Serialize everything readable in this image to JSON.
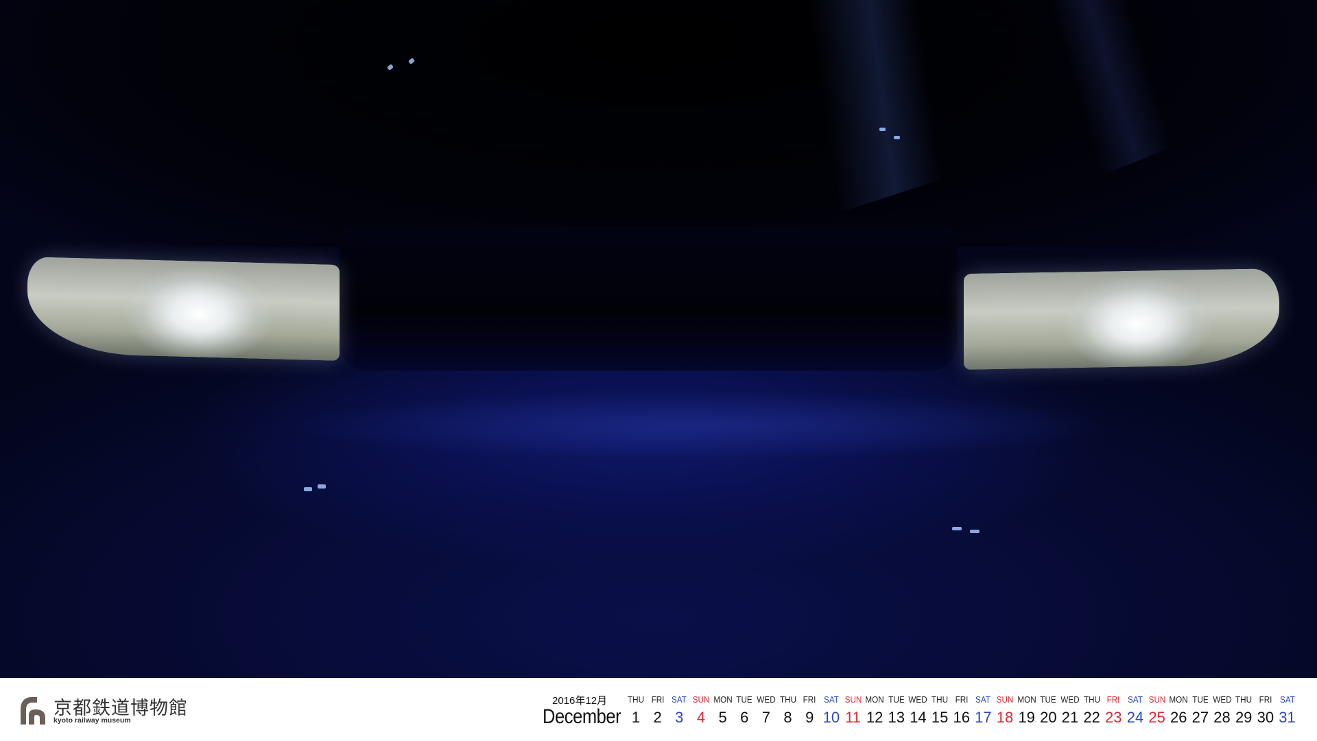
{
  "photo": {
    "subject": "train-front-headlights"
  },
  "logo": {
    "name_jp": "京都鉄道博物館",
    "name_en": "kyoto railway museum"
  },
  "calendar": {
    "year_month": "2016年12月",
    "month": "December",
    "days": [
      {
        "dow": "THU",
        "num": "1",
        "type": "weekday"
      },
      {
        "dow": "FRI",
        "num": "2",
        "type": "weekday"
      },
      {
        "dow": "SAT",
        "num": "3",
        "type": "sat"
      },
      {
        "dow": "SUN",
        "num": "4",
        "type": "sun"
      },
      {
        "dow": "MON",
        "num": "5",
        "type": "weekday"
      },
      {
        "dow": "TUE",
        "num": "6",
        "type": "weekday"
      },
      {
        "dow": "WED",
        "num": "7",
        "type": "weekday"
      },
      {
        "dow": "THU",
        "num": "8",
        "type": "weekday"
      },
      {
        "dow": "FRI",
        "num": "9",
        "type": "weekday"
      },
      {
        "dow": "SAT",
        "num": "10",
        "type": "sat"
      },
      {
        "dow": "SUN",
        "num": "11",
        "type": "sun"
      },
      {
        "dow": "MON",
        "num": "12",
        "type": "weekday"
      },
      {
        "dow": "TUE",
        "num": "13",
        "type": "weekday"
      },
      {
        "dow": "WED",
        "num": "14",
        "type": "weekday"
      },
      {
        "dow": "THU",
        "num": "15",
        "type": "weekday"
      },
      {
        "dow": "FRI",
        "num": "16",
        "type": "weekday"
      },
      {
        "dow": "SAT",
        "num": "17",
        "type": "sat"
      },
      {
        "dow": "SUN",
        "num": "18",
        "type": "sun"
      },
      {
        "dow": "MON",
        "num": "19",
        "type": "weekday"
      },
      {
        "dow": "TUE",
        "num": "20",
        "type": "weekday"
      },
      {
        "dow": "WED",
        "num": "21",
        "type": "weekday"
      },
      {
        "dow": "THU",
        "num": "22",
        "type": "weekday"
      },
      {
        "dow": "FRI",
        "num": "23",
        "type": "hol"
      },
      {
        "dow": "SAT",
        "num": "24",
        "type": "sat"
      },
      {
        "dow": "SUN",
        "num": "25",
        "type": "sun"
      },
      {
        "dow": "MON",
        "num": "26",
        "type": "weekday"
      },
      {
        "dow": "TUE",
        "num": "27",
        "type": "weekday"
      },
      {
        "dow": "WED",
        "num": "28",
        "type": "weekday"
      },
      {
        "dow": "THU",
        "num": "29",
        "type": "weekday"
      },
      {
        "dow": "FRI",
        "num": "30",
        "type": "weekday"
      },
      {
        "dow": "SAT",
        "num": "31",
        "type": "sat"
      }
    ]
  },
  "colors": {
    "saturday": "#2a48b8",
    "sunday_holiday": "#d92a36",
    "weekday": "#111111"
  }
}
